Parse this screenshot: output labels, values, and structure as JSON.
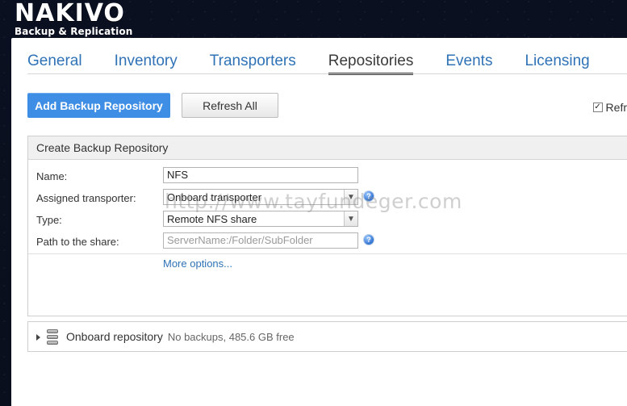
{
  "brand": {
    "name": "NAKIVO",
    "product": "Backup & Replication"
  },
  "tabs": [
    {
      "label": "General"
    },
    {
      "label": "Inventory"
    },
    {
      "label": "Transporters"
    },
    {
      "label": "Repositories"
    },
    {
      "label": "Events"
    },
    {
      "label": "Licensing"
    }
  ],
  "toolbar": {
    "add_button": "Add Backup Repository",
    "refresh_button": "Refresh All",
    "autorefresh_label": "Refr",
    "autorefresh_checked": true
  },
  "create_panel": {
    "title": "Create Backup Repository",
    "fields": {
      "name_label": "Name:",
      "name_value": "NFS",
      "transporter_label": "Assigned transporter:",
      "transporter_value": "Onboard transporter",
      "type_label": "Type:",
      "type_value": "Remote NFS share",
      "path_label": "Path to the share:",
      "path_placeholder": "ServerName:/Folder/SubFolder"
    },
    "more_options": "More options..."
  },
  "repository_list": {
    "items": [
      {
        "name": "Onboard repository",
        "meta": "No backups, 485.6 GB free"
      }
    ]
  },
  "watermark": "http://www.tayfundeger.com",
  "colors": {
    "accent": "#3f8ee5",
    "link": "#2f73b6",
    "active_tab": "#3b3b3b"
  }
}
